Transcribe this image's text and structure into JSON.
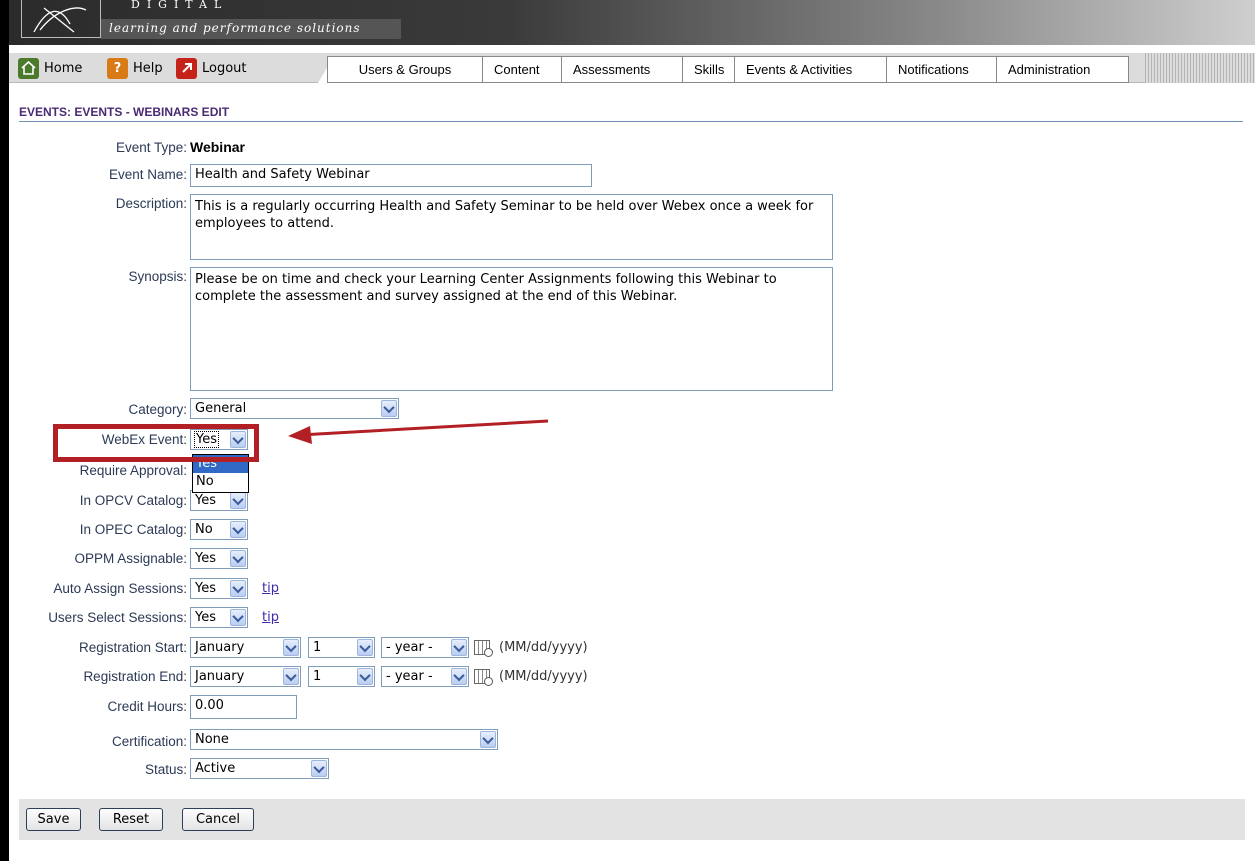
{
  "brand": {
    "top": "DIGITAL",
    "tagline": "learning and performance solutions"
  },
  "quick_links": [
    {
      "label": "Home",
      "icon": "home-icon"
    },
    {
      "label": "Help",
      "icon": "help-icon"
    },
    {
      "label": "Logout",
      "icon": "logout-icon"
    }
  ],
  "tabs": [
    "Users & Groups",
    "Content",
    "Assessments",
    "Skills",
    "Events & Activities",
    "Notifications",
    "Administration"
  ],
  "page_title": "EVENTS: EVENTS - WEBINARS EDIT",
  "form": {
    "event_type": {
      "label": "Event Type:",
      "value": "Webinar"
    },
    "event_name": {
      "label": "Event Name:",
      "value": "Health and Safety Webinar"
    },
    "description": {
      "label": "Description:",
      "value": "This is a regularly occurring Health and Safety Seminar to be held over Webex once a week for employees to attend."
    },
    "synopsis": {
      "label": "Synopsis:",
      "value": "Please be on time and check your Learning Center Assignments following this Webinar to complete the assessment and survey assigned at the end of this Webinar."
    },
    "category": {
      "label": "Category:",
      "value": "General"
    },
    "webex_event": {
      "label": "WebEx Event:",
      "value": "Yes",
      "options": [
        "Yes",
        "No"
      ]
    },
    "require_approval": {
      "label": "Require Approval:"
    },
    "in_opcv": {
      "label": "In OPCV Catalog:",
      "value": "Yes"
    },
    "in_opec": {
      "label": "In OPEC Catalog:",
      "value": "No"
    },
    "oppm": {
      "label": "OPPM Assignable:",
      "value": "Yes"
    },
    "auto_assign": {
      "label": "Auto Assign Sessions:",
      "value": "Yes",
      "tip": "tip"
    },
    "users_select": {
      "label": "Users Select Sessions:",
      "value": "Yes",
      "tip": "tip"
    },
    "reg_start": {
      "label": "Registration Start:",
      "month": "January",
      "day": "1",
      "year": "- year -",
      "format": "(MM/dd/yyyy)"
    },
    "reg_end": {
      "label": "Registration End:",
      "month": "January",
      "day": "1",
      "year": "- year -",
      "format": "(MM/dd/yyyy)"
    },
    "credit_hours": {
      "label": "Credit Hours:",
      "value": "0.00"
    },
    "certification": {
      "label": "Certification:",
      "value": "None"
    },
    "status": {
      "label": "Status:",
      "value": "Active"
    }
  },
  "buttons": {
    "save": "Save",
    "reset": "Reset",
    "cancel": "Cancel"
  },
  "colors": {
    "title": "#4b2a74",
    "highlight": "#b21f24",
    "selected_option": "#3169c6"
  }
}
